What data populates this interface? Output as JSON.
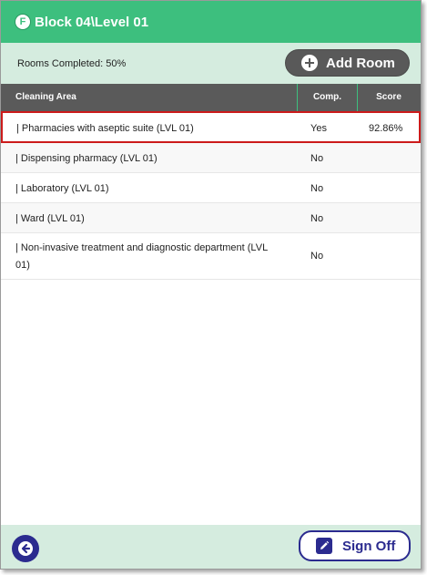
{
  "header": {
    "logo_letter": "F",
    "title": "Block 04\\Level 01"
  },
  "summary": {
    "rooms_completed": "Rooms Completed: 50%",
    "add_room_label": "Add Room"
  },
  "table": {
    "columns": [
      "Cleaning Area",
      "Comp.",
      "Score"
    ],
    "rows": [
      {
        "area": "| Pharmacies with aseptic suite (LVL 01)",
        "comp": "Yes",
        "score": "92.86%"
      },
      {
        "area": "| Dispensing pharmacy (LVL 01)",
        "comp": "No",
        "score": ""
      },
      {
        "area": "| Laboratory (LVL 01)",
        "comp": "No",
        "score": ""
      },
      {
        "area": "| Ward (LVL 01)",
        "comp": "No",
        "score": ""
      },
      {
        "area_line1": "| Non-invasive treatment and diagnostic department (LVL",
        "area_line2": "01)",
        "comp": "No",
        "score": ""
      }
    ]
  },
  "footer": {
    "sign_off_label": "Sign Off"
  },
  "colors": {
    "header_green": "#3dbf7e",
    "panel_green": "#d5ecdf",
    "table_header": "#5a5a5a",
    "navy": "#2b2b8f",
    "selection_red": "#cc1b1b"
  },
  "icons": [
    "logo-icon",
    "plus-circle-icon",
    "back-arrow-icon",
    "pencil-icon"
  ]
}
